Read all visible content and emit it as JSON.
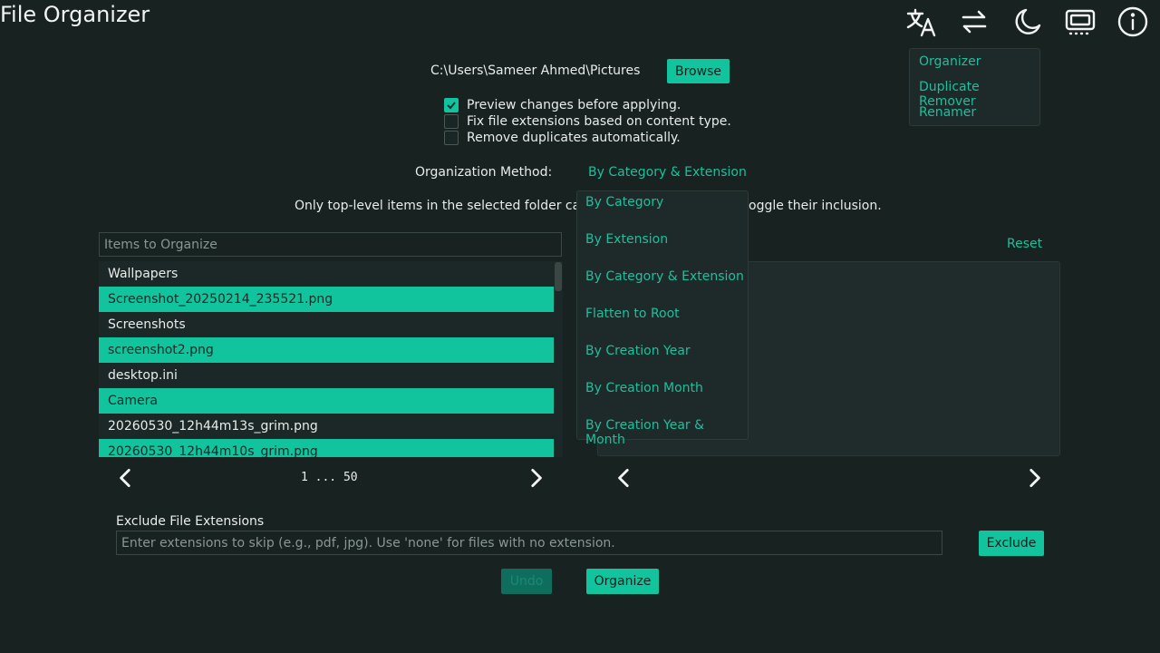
{
  "app": {
    "title": "File Organizer"
  },
  "toolbar": {
    "icons": [
      "translate-icon",
      "swap-icon",
      "moon-icon",
      "screen-icon",
      "info-icon"
    ]
  },
  "mode_menu": {
    "items": [
      "Organizer",
      "Duplicate Remover",
      "Renamer"
    ]
  },
  "folder": {
    "path": "C:\\Users\\Sameer Ahmed\\Pictures",
    "browse_label": "Browse"
  },
  "options": [
    {
      "label": "Preview changes before applying.",
      "checked": true
    },
    {
      "label": "Fix file extensions based on content type.",
      "checked": false
    },
    {
      "label": "Remove duplicates automatically.",
      "checked": false
    }
  ],
  "method": {
    "label": "Organization Method:",
    "selected": "By Category & Extension",
    "options": [
      "By Category",
      "By Extension",
      "By Category & Extension",
      "Flatten to Root",
      "By Creation Year",
      "By Creation Month",
      "By Creation Year & Month"
    ]
  },
  "info_text": {
    "left": "Only top-level items in the selected folder can b",
    "right": "oggle their inclusion."
  },
  "items_panel": {
    "header_placeholder": "Items to Organize",
    "rows": [
      {
        "name": "Wallpapers",
        "selected": false
      },
      {
        "name": "Screenshot_20250214_235521.png",
        "selected": true
      },
      {
        "name": "Screenshots",
        "selected": false
      },
      {
        "name": "screenshot2.png",
        "selected": true
      },
      {
        "name": "desktop.ini",
        "selected": false
      },
      {
        "name": "Camera",
        "selected": true
      },
      {
        "name": "20260530_12h44m13s_grim.png",
        "selected": false
      },
      {
        "name": "20260530_12h44m10s_grim.png",
        "selected": true
      }
    ],
    "pager_text": "1 ... 50"
  },
  "preview_panel": {
    "reset_label": "Reset"
  },
  "exclude": {
    "label": "Exclude File Extensions",
    "placeholder": "Enter extensions to skip (e.g., pdf, jpg). Use 'none' for files with no extension.",
    "button_label": "Exclude"
  },
  "actions": {
    "undo_label": "Undo",
    "organize_label": "Organize"
  },
  "colors": {
    "background": "#172221",
    "accent": "#12c49d",
    "accent_text": "#1fbf9e",
    "panel": "#1f2c2b"
  }
}
